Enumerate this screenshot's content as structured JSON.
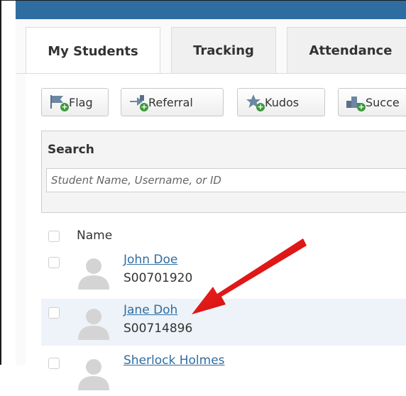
{
  "tabs": [
    {
      "label": "My Students"
    },
    {
      "label": "Tracking"
    },
    {
      "label": "Attendance"
    }
  ],
  "actions": {
    "flag": "Flag",
    "referral": "Referral",
    "kudos": "Kudos",
    "success": "Succe"
  },
  "search": {
    "label": "Search",
    "placeholder": "Student Name, Username, or ID"
  },
  "list": {
    "header": "Name",
    "students": [
      {
        "name": "John Doe",
        "id": "S00701920"
      },
      {
        "name": "Jane Doh",
        "id": "S00714896"
      },
      {
        "name": "Sherlock Holmes",
        "id": ""
      }
    ]
  },
  "colors": {
    "brand": "#2f6da1",
    "annotation_arrow": "#e01010"
  }
}
